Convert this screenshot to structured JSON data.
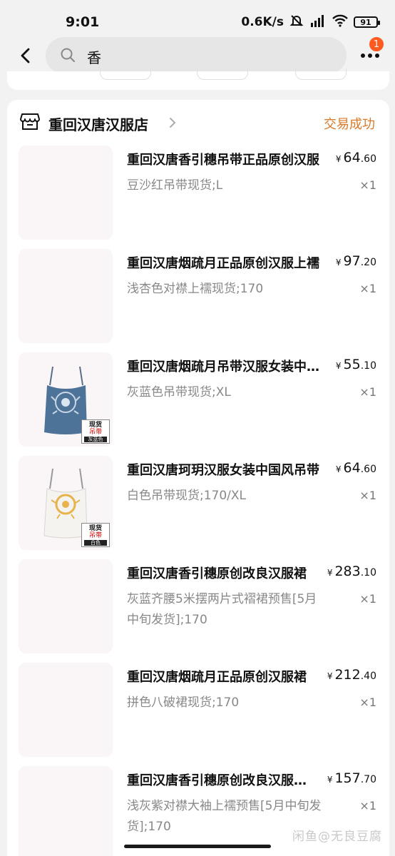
{
  "status_bar": {
    "time": "9:01",
    "net_speed": "0.6K/s",
    "battery": "91"
  },
  "header": {
    "search_query": "香",
    "notification_count": "1"
  },
  "order": {
    "shop_name": "重回汉唐汉服店",
    "status": "交易成功",
    "status_color": "#d97a2b",
    "items": [
      {
        "title": "重回汉唐香引穗吊带正品原创汉服",
        "spec": "豆沙红吊带现货;L",
        "currency": "¥",
        "price_int": "64",
        "price_dec": ".60",
        "qty": "×1"
      },
      {
        "title": "重回汉唐烟疏月正品原创汉服上襦",
        "spec": "浅杏色对襟上襦现货;170",
        "currency": "¥",
        "price_int": "97",
        "price_dec": ".20",
        "qty": "×1"
      },
      {
        "title": "重回汉唐烟疏月吊带汉服女装中国风",
        "spec": "灰蓝色吊带现货;XL",
        "currency": "¥",
        "price_int": "55",
        "price_dec": ".10",
        "qty": "×1",
        "tag": {
          "line1": "现货",
          "line2": "吊带",
          "line3": "灰蓝色"
        }
      },
      {
        "title": "重回汉唐珂玥汉服女装中国风吊带",
        "spec": "白色吊带现货;170/XL",
        "currency": "¥",
        "price_int": "64",
        "price_dec": ".60",
        "qty": "×1",
        "tag": {
          "line1": "现货",
          "line2": "吊带",
          "line3": "白色"
        }
      },
      {
        "title": "重回汉唐香引穗原创改良汉服裙",
        "spec": "灰蓝齐腰5米摆两片式褶裙预售[5月中旬发货];170",
        "currency": "¥",
        "price_int": "283",
        "price_dec": ".10",
        "qty": "×1"
      },
      {
        "title": "重回汉唐烟疏月正品原创汉服裙",
        "spec": "拼色八破裙现货;170",
        "currency": "¥",
        "price_int": "212",
        "price_dec": ".40",
        "qty": "×1"
      },
      {
        "title": "重回汉唐香引穗原创改良汉服上襦",
        "spec": "浅灰紫对襟大袖上襦预售[5月中旬发货];170",
        "currency": "¥",
        "price_int": "157",
        "price_dec": ".70",
        "qty": "×1"
      }
    ]
  },
  "watermark": "闲鱼@无良豆腐"
}
